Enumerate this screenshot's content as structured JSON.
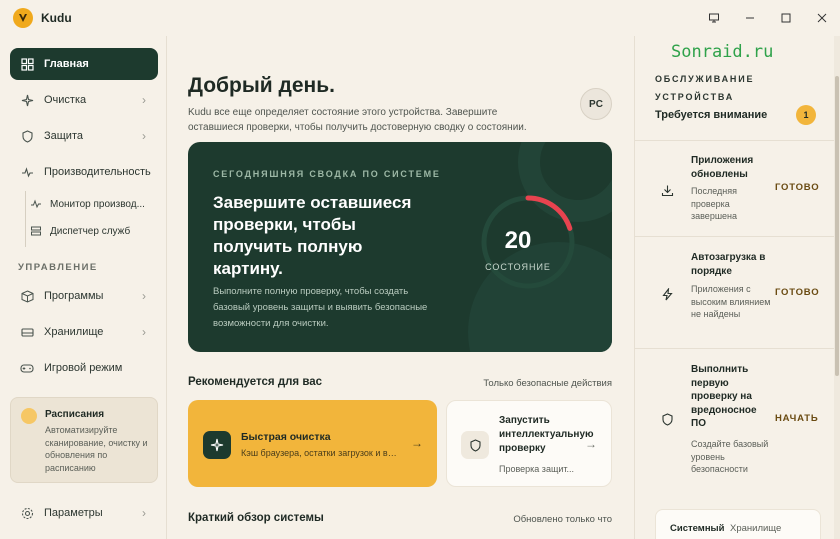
{
  "window": {
    "title": "Kudu",
    "controls": [
      "monitor-icon",
      "minimize-icon",
      "maximize-icon",
      "close-icon"
    ]
  },
  "sidebar": {
    "items": [
      {
        "label": "Главная",
        "icon": "grid-icon",
        "active": true
      },
      {
        "label": "Очистка",
        "icon": "sparkle-icon"
      },
      {
        "label": "Защита",
        "icon": "shield-icon"
      },
      {
        "label": "Производительность",
        "icon": "pulse-icon"
      }
    ],
    "subitems": [
      {
        "label": "Монитор производ...",
        "icon": "pulse-icon"
      },
      {
        "label": "Диспетчер служб",
        "icon": "list-icon"
      }
    ],
    "section_label": "УПРАВЛЕНИЕ",
    "manage_items": [
      {
        "label": "Программы",
        "icon": "box-icon"
      },
      {
        "label": "Хранилище",
        "icon": "storage-icon"
      },
      {
        "label": "Игровой режим",
        "icon": "gamepad-icon"
      }
    ],
    "schedule": {
      "title": "Расписания",
      "description": "Автоматизируйте сканирование, очистку и обновления по расписанию"
    },
    "settings_label": "Параметры"
  },
  "main": {
    "greeting": "Добрый день.",
    "greeting_sub": "Kudu все еще определяет состояние этого устройства. Завершите оставшиеся проверки, чтобы получить достоверную сводку о состоянии.",
    "avatar_initials": "PC",
    "hero": {
      "eyebrow": "СЕГОДНЯШНЯЯ СВОДКА ПО СИСТЕМЕ",
      "title": "Завершите оставшиеся проверки, чтобы получить полную картину.",
      "description": "Выполните полную проверку, чтобы создать базовый уровень защиты и выявить безопасные возможности для очистки.",
      "score": "20",
      "score_label": "СОСТОЯНИЕ",
      "score_value": 20,
      "accent": "#e8434f"
    },
    "recommended": {
      "title": "Рекомендуется для вас",
      "link": "Только безопасные действия",
      "cards": [
        {
          "title": "Быстрая очистка",
          "description": "Кэш браузера, остатки загрузок и вре..."
        },
        {
          "title": "Запустить интеллектуальную проверку",
          "description": "Проверка защит..."
        }
      ]
    },
    "overview": {
      "title": "Краткий обзор системы",
      "link": "Обновлено только что"
    }
  },
  "right_panel": {
    "watermark": "Sonraid.ru",
    "eyebrow": "ОБСЛУЖИВАНИЕ УСТРОЙСТВА",
    "heading": "Требуется внимание",
    "badge": "1",
    "tasks": [
      {
        "title": "Приложения обновлены",
        "description": "Последняя проверка завершена",
        "action": "ГОТОВО",
        "icon": "download-icon"
      },
      {
        "title": "Автозагрузка в порядке",
        "description": "Приложения с высоким влиянием не найдены",
        "action": "ГОТОВО",
        "icon": "bolt-icon"
      },
      {
        "title": "Выполнить первую проверку на вредоносное ПО",
        "description": "Создайте базовый уровень безопасности",
        "action": "НАЧАТЬ",
        "icon": "shield-icon"
      }
    ],
    "tabs": [
      "Системный",
      "Хранилище"
    ]
  },
  "colors": {
    "brand_dark": "#1d3a2e",
    "accent_yellow": "#f2b53b",
    "background": "#f6f1e8"
  }
}
